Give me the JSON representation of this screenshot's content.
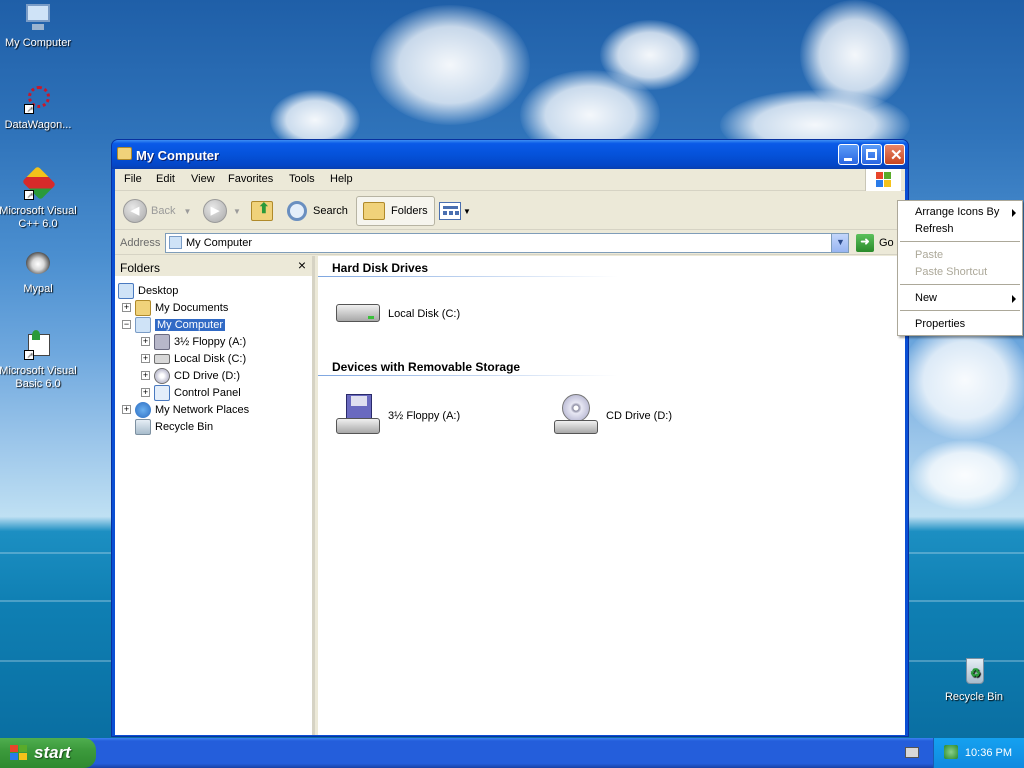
{
  "desktop": {
    "icons": [
      {
        "label": "My Computer"
      },
      {
        "label": "DataWagon..."
      },
      {
        "label": "Microsoft Visual C++ 6.0"
      },
      {
        "label": "Mypal"
      },
      {
        "label": "Microsoft Visual Basic 6.0"
      },
      {
        "label": "Recycle Bin"
      }
    ]
  },
  "window": {
    "title": "My Computer",
    "menu": [
      "File",
      "Edit",
      "View",
      "Favorites",
      "Tools",
      "Help"
    ],
    "toolbar": {
      "back": "Back",
      "search": "Search",
      "folders": "Folders"
    },
    "address": {
      "label": "Address",
      "value": "My Computer",
      "go": "Go"
    },
    "folders_pane": {
      "title": "Folders",
      "close": "×",
      "tree": [
        {
          "label": "Desktop"
        },
        {
          "label": "My Documents"
        },
        {
          "label": "My Computer"
        },
        {
          "label": "3½ Floppy (A:)"
        },
        {
          "label": "Local Disk (C:)"
        },
        {
          "label": "CD Drive (D:)"
        },
        {
          "label": "Control Panel"
        },
        {
          "label": "My Network Places"
        },
        {
          "label": "Recycle Bin"
        }
      ]
    },
    "content": {
      "groups": [
        {
          "title": "Hard Disk Drives",
          "items": [
            {
              "label": "Local Disk (C:)"
            }
          ]
        },
        {
          "title": "Devices with Removable Storage",
          "items": [
            {
              "label": "3½ Floppy (A:)"
            },
            {
              "label": "CD Drive (D:)"
            }
          ]
        }
      ]
    }
  },
  "context_menu": {
    "items": [
      {
        "label": "Arrange Icons By"
      },
      {
        "label": "Refresh"
      },
      {
        "label": "Paste"
      },
      {
        "label": "Paste Shortcut"
      },
      {
        "label": "New"
      },
      {
        "label": "Properties"
      }
    ]
  },
  "taskbar": {
    "start": "start",
    "clock": "10:36 PM"
  },
  "colors": {
    "title_blue": "#0a5ae8",
    "selection": "#316ac5",
    "start_green": "#3c9a3c"
  }
}
